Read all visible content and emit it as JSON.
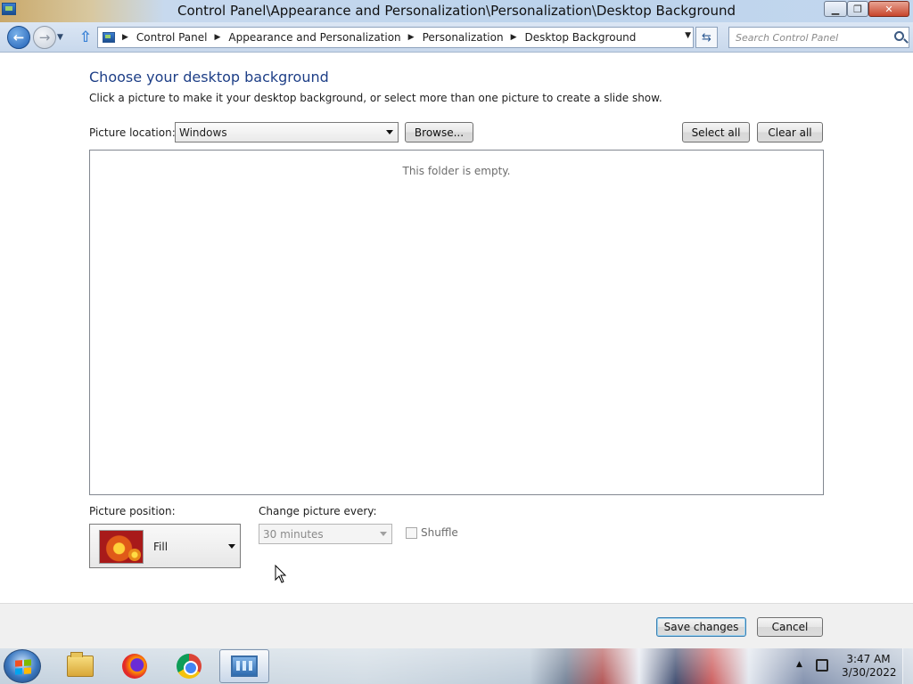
{
  "window": {
    "title": "Control Panel\\Appearance and Personalization\\Personalization\\Desktop Background",
    "controls": {
      "minimize_icon": "minimize-icon",
      "maximize_icon": "restore-icon",
      "close_icon": "close-icon"
    }
  },
  "address_bar": {
    "breadcrumb": [
      "Control Panel",
      "Appearance and Personalization",
      "Personalization",
      "Desktop Background"
    ],
    "search_placeholder": "Search Control Panel"
  },
  "main": {
    "heading": "Choose your desktop background",
    "instructions": "Click a picture to make it your desktop background, or select more than one picture to create a slide show.",
    "picture_location_label": "Picture location:",
    "picture_location_value": "Windows",
    "browse_label": "Browse...",
    "select_all_label": "Select all",
    "clear_all_label": "Clear all",
    "empty_message": "This folder is empty.",
    "picture_position_label": "Picture position:",
    "picture_position_value": "Fill",
    "change_picture_label": "Change picture every:",
    "change_picture_value": "30 minutes",
    "shuffle_label": "Shuffle",
    "shuffle_checked": false
  },
  "footer": {
    "save_label": "Save changes",
    "cancel_label": "Cancel"
  },
  "taskbar": {
    "apps": [
      "windows-explorer",
      "firefox",
      "chrome",
      "control-panel"
    ],
    "active_app": "control-panel",
    "clock_time": "3:47 AM",
    "clock_date": "3/30/2022"
  },
  "colors": {
    "heading": "#1e3f87",
    "save_border": "#3c7fb1",
    "start_flag": [
      "#f25022",
      "#7fba00",
      "#00a4ef",
      "#ffb900"
    ]
  }
}
